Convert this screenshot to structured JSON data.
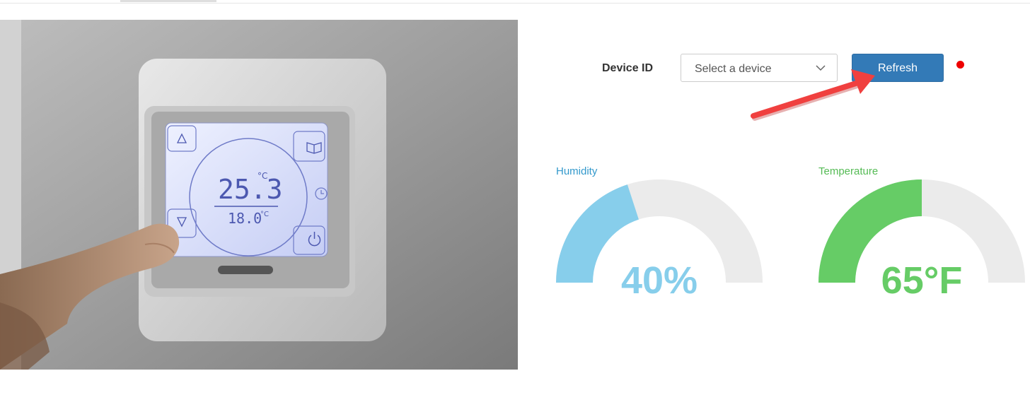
{
  "form": {
    "device_label": "Device ID",
    "device_select_value": "Select a device",
    "refresh_label": "Refresh",
    "status_color": "#ee0000"
  },
  "gauges": [
    {
      "title": "Humidity",
      "value_text": "40%",
      "fraction": 0.4,
      "color": "#87ceeb",
      "title_color": "#3399cc"
    },
    {
      "title": "Temperature",
      "value_text": "65°F",
      "fraction": 0.5,
      "color": "#66cc66",
      "title_color": "#55bb55"
    }
  ],
  "thermostat_display": {
    "main": "25.3",
    "set": "18.0",
    "unit": "°C"
  },
  "icons": [
    "chevron-down-icon",
    "arrow-annotation-icon",
    "up-triangle-icon",
    "down-triangle-icon",
    "book-icon",
    "clock-icon",
    "power-icon"
  ]
}
